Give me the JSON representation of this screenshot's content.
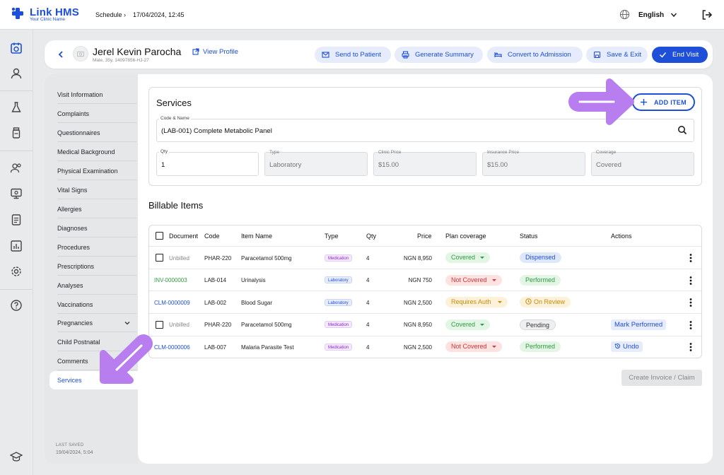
{
  "brand": {
    "name": "Link HMS",
    "subtitle": "Your Clinic Name"
  },
  "breadcrumb": {
    "item1": "Schedule",
    "sep": "›",
    "item2": "17/04/2024, 12:45"
  },
  "language": "English",
  "patient": {
    "name": "Jerel Kevin Parocha",
    "meta": "Male, 35y, 14097856-HJ-27",
    "view_profile": "View Profile"
  },
  "actions": {
    "send": "Send to Patient",
    "summary": "Generate Summary",
    "admission": "Convert to Admission",
    "save": "Save & Exit",
    "end": "End Visit"
  },
  "sidebar": {
    "items": [
      {
        "label": "Visit Information"
      },
      {
        "label": "Complaints"
      },
      {
        "label": "Questionnaires"
      },
      {
        "label": "Medical Background"
      },
      {
        "label": "Physical Examination"
      },
      {
        "label": "Vital Signs"
      },
      {
        "label": "Allergies"
      },
      {
        "label": "Diagnoses"
      },
      {
        "label": "Procedures"
      },
      {
        "label": "Prescriptions"
      },
      {
        "label": "Analyses"
      },
      {
        "label": "Vaccinations"
      },
      {
        "label": "Pregnancies"
      },
      {
        "label": "Child Postnatal"
      },
      {
        "label": "Comments"
      },
      {
        "label": "Services"
      }
    ],
    "active": "Services",
    "last_saved_label": "LAST SAVED",
    "last_saved_value": "19/04/2024, 5:04"
  },
  "services": {
    "title": "Services",
    "add_item": "ADD ITEM",
    "code_name_label": "Code & Name",
    "code_name_value": "(LAB-001) Complete Metabolic Panel",
    "qty_label": "Qty",
    "qty_value": "1",
    "type_label": "Type",
    "type_value": "Laboratory",
    "clinic_price_label": "Clinic Price",
    "clinic_price_value": "$15.00",
    "insurance_price_label": "Insurance Price",
    "insurance_price_value": "$15.00",
    "coverage_label": "Coverage",
    "coverage_value": "Covered"
  },
  "billable": {
    "title": "Billable Items",
    "headers": {
      "document": "Document",
      "code": "Code",
      "item_name": "Item Name",
      "type": "Type",
      "qty": "Qty",
      "price": "Price",
      "plan_coverage": "Plan coverage",
      "status": "Status",
      "actions": "Actions"
    },
    "rows": [
      {
        "document": "Unbilled",
        "code": "PHAR-220",
        "name": "Paracetamol 500mg",
        "type": "Medication",
        "qty": "4",
        "price": "NGN 8,950",
        "coverage": "Covered",
        "status": "Dispensed",
        "action": ""
      },
      {
        "document": "INV-0000003",
        "code": "LAB-014",
        "name": "Urinalysis",
        "type": "Laboratory",
        "qty": "4",
        "price": "NGN 750",
        "coverage": "Not Covered",
        "status": "Performed",
        "action": ""
      },
      {
        "document": "CLM-0000009",
        "code": "LAB-002",
        "name": "Blood Sugar",
        "type": "Laboratory",
        "qty": "4",
        "price": "NGN 2,500",
        "coverage": "Requires Auth",
        "status": "On Review",
        "action": ""
      },
      {
        "document": "Unbilled",
        "code": "PHAR-220",
        "name": "Paracetamol 500mg",
        "type": "Medication",
        "qty": "4",
        "price": "NGN 8,950",
        "coverage": "Covered",
        "status": "Pending",
        "action": "Mark Performed"
      },
      {
        "document": "CLM-0000006",
        "code": "LAB-007",
        "name": "Malaria Parasite Test",
        "type": "Medication",
        "qty": "4",
        "price": "NGN 2,500",
        "coverage": "Not Covered",
        "status": "Performed",
        "action": "Undo"
      }
    ],
    "create_invoice": "Create Invoice / Claim"
  },
  "colors": {
    "brand": "#1d4fd8",
    "highlight_arrow": "#b87ef0",
    "covered_bg": "#e3f6e6",
    "covered_fg": "#2e9a3e",
    "notcovered_bg": "#fde2e2",
    "notcovered_fg": "#d73535",
    "auth_bg": "#fdf2d9",
    "auth_fg": "#c98a0a",
    "dispensed_bg": "#dfe8fb",
    "dispensed_fg": "#1d4fd8",
    "pending_bg": "#eeeff1",
    "pending_fg": "#333333"
  }
}
